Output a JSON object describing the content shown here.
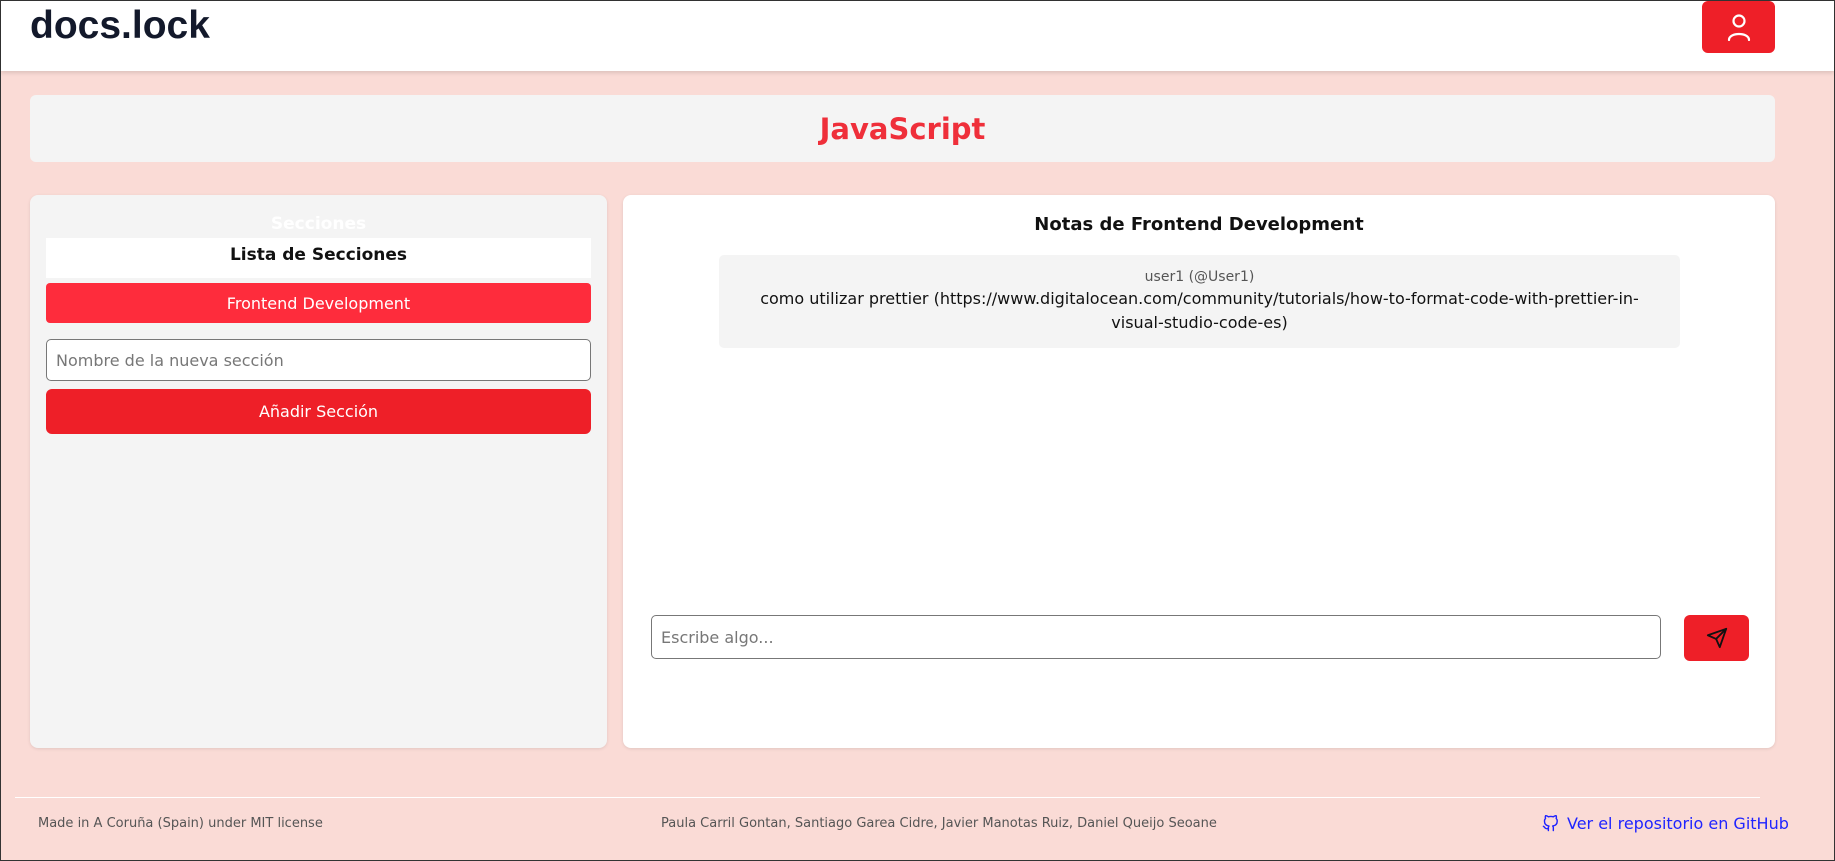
{
  "header": {
    "logo": "docs.lock",
    "user_icon": "user-icon"
  },
  "page": {
    "title": "JavaScript"
  },
  "sections_panel": {
    "ghost_heading": "Secciones",
    "list_title": "Lista de Secciones",
    "items": [
      {
        "label": "Frontend Development"
      }
    ],
    "new_section_placeholder": "Nombre de la nueva sección",
    "add_button_label": "Añadir Sección"
  },
  "notes_panel": {
    "title": "Notas de Frontend Development",
    "notes": [
      {
        "author": "user1 (@User1)",
        "text": "como utilizar prettier (https://www.digitalocean.com/community/tutorials/how-to-format-code-with-prettier-in-visual-studio-code-es)"
      }
    ],
    "message_placeholder": "Escribe algo...",
    "send_icon": "send-icon"
  },
  "footer": {
    "left": "Made in A Coruña (Spain) under MIT license",
    "center": "Paula Carril Gontan, Santiago Garea Cidre, Javier Manotas Ruiz, Daniel Queijo Seoane",
    "repo_link": "Ver el repositorio en GitHub",
    "repo_icon": "github-icon"
  },
  "colors": {
    "background": "#fadbd6",
    "accent": "#ee1f28",
    "title": "#ef2f3a",
    "link": "#2024ff"
  }
}
